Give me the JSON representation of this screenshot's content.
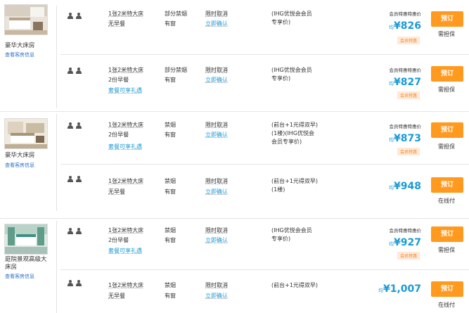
{
  "rooms": [
    {
      "name": "豪华大床房",
      "link": "查看客房信息",
      "rates": [
        {
          "bed": "1张2米特大床",
          "meal": "无早餐",
          "pkg": "",
          "smoke": "部分禁烟",
          "window": "有窗",
          "cancel": "限时取消",
          "confirm": "立即确认",
          "note1": "(IHG优悦会会员",
          "note2": "专享价)",
          "note3": "",
          "price_label": "会员特惠特惠价",
          "avg": "均",
          "price": "¥826",
          "badge": "会员特惠",
          "button": "预订",
          "pay": "需担保"
        },
        {
          "bed": "1张2米特大床",
          "meal": "2份早餐",
          "pkg": "套餐可享礼遇",
          "smoke": "部分禁烟",
          "window": "有窗",
          "cancel": "限时取消",
          "confirm": "立即确认",
          "note1": "(IHG优悦会会员",
          "note2": "专享价)",
          "note3": "",
          "price_label": "会员特惠特惠价",
          "avg": "均",
          "price": "¥827",
          "badge": "会员特惠",
          "button": "预订",
          "pay": "需担保"
        }
      ]
    },
    {
      "name": "豪华大床房",
      "link": "查看客房信息",
      "rates": [
        {
          "bed": "1张2米特大床",
          "meal": "2份早餐",
          "pkg": "套餐可享礼遇",
          "smoke": "禁烟",
          "window": "有窗",
          "cancel": "限时取消",
          "confirm": "立即确认",
          "note1": "(前台+1元得双早)",
          "note2": "(1楼)(IHG优悦会",
          "note3": "会员专享价)",
          "price_label": "会员特惠特惠价",
          "avg": "均",
          "price": "¥873",
          "badge": "会员特惠",
          "button": "预订",
          "pay": "需担保"
        },
        {
          "bed": "1张2米特大床",
          "meal": "无早餐",
          "pkg": "",
          "smoke": "禁烟",
          "window": "有窗",
          "cancel": "限时取消",
          "confirm": "立即确认",
          "note1": "(前台+1元得双早)",
          "note2": "(1楼)",
          "note3": "",
          "price_label": "",
          "avg": "均",
          "price": "¥948",
          "badge": "",
          "button": "预订",
          "pay": "在线付"
        }
      ]
    },
    {
      "name": "庭院景观高级大床房",
      "link": "查看客房信息",
      "rates": [
        {
          "bed": "1张2米特大床",
          "meal": "2份早餐",
          "pkg": "套餐可享礼遇",
          "smoke": "禁烟",
          "window": "有窗",
          "cancel": "限时取消",
          "confirm": "立即确认",
          "note1": "(IHG优悦会会员",
          "note2": "专享价)",
          "note3": "",
          "price_label": "会员特惠特惠价",
          "avg": "均",
          "price": "¥927",
          "badge": "会员特惠",
          "button": "预订",
          "pay": "需担保"
        },
        {
          "bed": "1张2米特大床",
          "meal": "无早餐",
          "pkg": "",
          "smoke": "禁烟",
          "window": "有窗",
          "cancel": "限时取消",
          "confirm": "立即确认",
          "note1": "(前台+1元得双早)",
          "note2": "",
          "note3": "",
          "price_label": "",
          "avg": "均",
          "price": "¥1,007",
          "badge": "",
          "button": "预订",
          "pay": "在线付"
        }
      ]
    }
  ],
  "colors": {
    "accent": "#1a9ad6",
    "button": "#ff9a1f",
    "badge_text": "#f08a2e",
    "badge_bg": "#ffe9d6",
    "link": "#2a6fc7"
  }
}
